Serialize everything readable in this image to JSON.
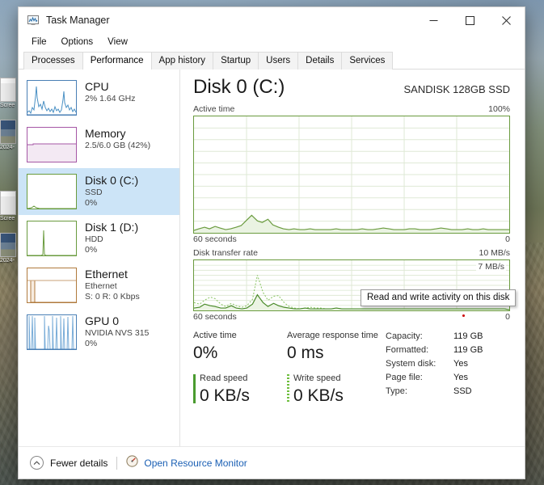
{
  "window": {
    "title": "Task Manager",
    "icon": "task-manager-icon",
    "controls": {
      "minimize": "–",
      "maximize": "☐",
      "close": "✕"
    }
  },
  "menu": {
    "items": [
      "File",
      "Options",
      "View"
    ]
  },
  "tabs": {
    "items": [
      {
        "label": "Processes",
        "active": false
      },
      {
        "label": "Performance",
        "active": true
      },
      {
        "label": "App history",
        "active": false
      },
      {
        "label": "Startup",
        "active": false
      },
      {
        "label": "Users",
        "active": false
      },
      {
        "label": "Details",
        "active": false
      },
      {
        "label": "Services",
        "active": false
      }
    ]
  },
  "sidebar": {
    "items": [
      {
        "name": "CPU",
        "line2": "2%  1.64 GHz",
        "line3": "",
        "selected": false,
        "color": "#4a90c4"
      },
      {
        "name": "Memory",
        "line2": "2.5/6.0 GB (42%)",
        "line3": "",
        "selected": false,
        "color": "#a557a5"
      },
      {
        "name": "Disk 0 (C:)",
        "line2": "SSD",
        "line3": "0%",
        "selected": true,
        "color": "#6a9b3e"
      },
      {
        "name": "Disk 1 (D:)",
        "line2": "HDD",
        "line3": "0%",
        "selected": false,
        "color": "#6a9b3e"
      },
      {
        "name": "Ethernet",
        "line2": "Ethernet",
        "line3": "S: 0 R: 0 Kbps",
        "selected": false,
        "color": "#b07a3c"
      },
      {
        "name": "GPU 0",
        "line2": "NVIDIA NVS 315",
        "line3": "0%",
        "selected": false,
        "color": "#4a7fb5"
      }
    ]
  },
  "main": {
    "title": "Disk 0 (C:)",
    "model": "SANDISK 128GB SSD",
    "active_graph": {
      "label": "Active time",
      "max": "100%",
      "x_left": "60 seconds",
      "x_right": "0"
    },
    "transfer_graph": {
      "label": "Disk transfer rate",
      "max": "10 MB/s",
      "inline_max": "7 MB/s",
      "x_left": "60 seconds",
      "x_right": "0"
    },
    "tooltip": "Read and write activity on this disk",
    "stats": {
      "active_time_label": "Active time",
      "active_time_value": "0%",
      "response_label": "Average response time",
      "response_value": "0 ms",
      "read_label": "Read speed",
      "read_value": "0 KB/s",
      "write_label": "Write speed",
      "write_value": "0 KB/s",
      "details": [
        {
          "key": "Capacity:",
          "value": "119 GB"
        },
        {
          "key": "Formatted:",
          "value": "119 GB"
        },
        {
          "key": "System disk:",
          "value": "Yes"
        },
        {
          "key": "Page file:",
          "value": "Yes"
        },
        {
          "key": "Type:",
          "value": "SSD"
        }
      ]
    }
  },
  "footer": {
    "fewer_details": "Fewer details",
    "open_resource_monitor": "Open Resource Monitor"
  },
  "desktop": {
    "icons": [
      {
        "label": "Scree"
      },
      {
        "label": "2024-"
      },
      {
        "label": "Scree"
      },
      {
        "label": "2024-"
      }
    ]
  },
  "chart_data": [
    {
      "type": "area",
      "title": "Active time",
      "ylabel": "Active time (%)",
      "xlabel": "60 seconds",
      "ylim": [
        0,
        100
      ],
      "xlim": [
        0,
        60
      ],
      "grid": true,
      "series": [
        {
          "name": "Active time",
          "color": "#6a9b3e",
          "values": [
            2,
            3,
            1,
            2,
            4,
            3,
            2,
            1,
            2,
            3,
            6,
            10,
            5,
            4,
            6,
            3,
            2,
            1,
            1,
            2,
            1,
            1,
            2,
            1,
            1,
            1,
            1,
            2,
            1,
            1,
            1,
            1,
            2,
            1,
            1,
            2,
            3,
            2,
            1,
            1,
            1,
            2,
            2,
            1,
            1,
            1,
            2,
            3,
            2,
            1,
            1,
            1,
            2,
            1,
            1,
            2,
            1,
            1,
            1,
            1
          ]
        }
      ]
    },
    {
      "type": "line",
      "title": "Disk transfer rate",
      "ylabel": "MB/s",
      "xlabel": "60 seconds",
      "ylim": [
        0,
        10
      ],
      "xlim": [
        0,
        60
      ],
      "grid": true,
      "annotations": [
        "7 MB/s"
      ],
      "series": [
        {
          "name": "Read (solid)",
          "color": "#4a8b2a",
          "values": [
            0.4,
            0.6,
            1.2,
            1.0,
            0.8,
            0.5,
            0.4,
            0.9,
            0.5,
            0.3,
            0.4,
            1.0,
            3.2,
            1.6,
            0.8,
            1.4,
            1.0,
            0.6,
            0.3,
            0.2,
            0.2,
            0.3,
            0.2,
            0.2,
            0.2,
            0.2,
            0.2,
            0.3,
            0.2,
            0.2,
            0.2,
            0.2,
            0.2,
            0.2,
            0.2,
            0.2,
            0.2,
            0.2,
            0.2,
            0.2,
            0.2,
            0.2,
            0.2,
            0.2,
            0.2,
            0.2,
            0.2,
            0.2,
            0.2,
            0.2,
            0.2,
            0.2,
            0.2,
            0.2,
            0.2,
            0.2,
            0.2,
            0.2,
            0.2,
            0.1
          ]
        },
        {
          "name": "Write (dotted)",
          "color": "#8fc76a",
          "values": [
            1.6,
            1.2,
            2.0,
            2.6,
            2.4,
            1.2,
            0.8,
            1.4,
            0.9,
            0.7,
            0.9,
            2.2,
            7.0,
            3.6,
            2.0,
            2.8,
            3.0,
            1.6,
            0.8,
            0.4,
            0.3,
            0.5,
            0.6,
            0.5,
            0.4,
            0.3,
            0.3,
            0.4,
            0.3,
            0.3,
            0.3,
            0.3,
            0.3,
            0.3,
            0.3,
            0.3,
            0.3,
            0.3,
            0.3,
            0.3,
            0.3,
            0.3,
            0.3,
            0.3,
            0.3,
            0.3,
            0.3,
            0.3,
            0.3,
            0.3,
            0.3,
            0.3,
            0.3,
            0.3,
            0.3,
            0.3,
            0.3,
            0.3,
            0.3,
            0.2
          ]
        }
      ]
    }
  ]
}
